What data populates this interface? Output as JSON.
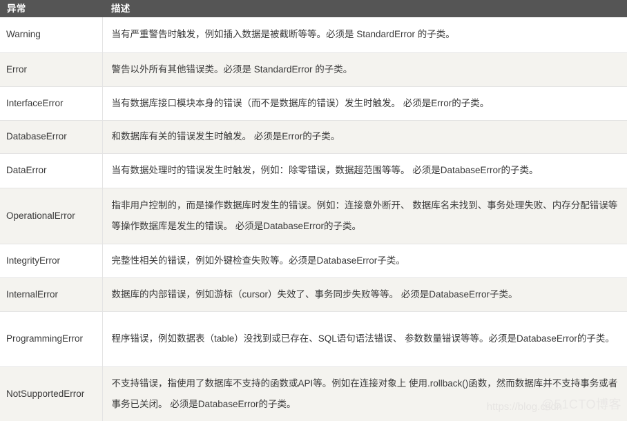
{
  "table": {
    "headers": {
      "exception": "异常",
      "description": "描述"
    },
    "rows": [
      {
        "exception": "Warning",
        "description": "当有严重警告时触发，例如插入数据是被截断等等。必须是 StandardError 的子类。"
      },
      {
        "exception": "Error",
        "description": "警告以外所有其他错误类。必须是 StandardError 的子类。"
      },
      {
        "exception": "InterfaceError",
        "description": "当有数据库接口模块本身的错误（而不是数据库的错误）发生时触发。 必须是Error的子类。"
      },
      {
        "exception": "DatabaseError",
        "description": "和数据库有关的错误发生时触发。 必须是Error的子类。"
      },
      {
        "exception": "DataError",
        "description": "当有数据处理时的错误发生时触发，例如：除零错误，数据超范围等等。 必须是DatabaseError的子类。"
      },
      {
        "exception": "OperationalError",
        "description": "指非用户控制的，而是操作数据库时发生的错误。例如：连接意外断开、 数据库名未找到、事务处理失败、内存分配错误等等操作数据库是发生的错误。 必须是DatabaseError的子类。"
      },
      {
        "exception": "IntegrityError",
        "description": "完整性相关的错误，例如外键检查失败等。必须是DatabaseError子类。"
      },
      {
        "exception": "InternalError",
        "description": "数据库的内部错误，例如游标（cursor）失效了、事务同步失败等等。 必须是DatabaseError子类。"
      },
      {
        "exception": "ProgrammingError",
        "description": "程序错误，例如数据表（table）没找到或已存在、SQL语句语法错误、 参数数量错误等等。必须是DatabaseError的子类。"
      },
      {
        "exception": "NotSupportedError",
        "description": "不支持错误，指使用了数据库不支持的函数或API等。例如在连接对象上 使用.rollback()函数，然而数据库并不支持事务或者事务已关闭。 必须是DatabaseError的子类。"
      }
    ]
  },
  "watermark": {
    "url": "https://blog.csdn",
    "brand": "@51CTO博客"
  },
  "colors": {
    "header_bg": "#555555",
    "header_text": "#ffffff",
    "row_odd_bg": "#ffffff",
    "row_even_bg": "#f4f3ef",
    "border": "#e3e3e3",
    "text": "#3a3a3a"
  }
}
